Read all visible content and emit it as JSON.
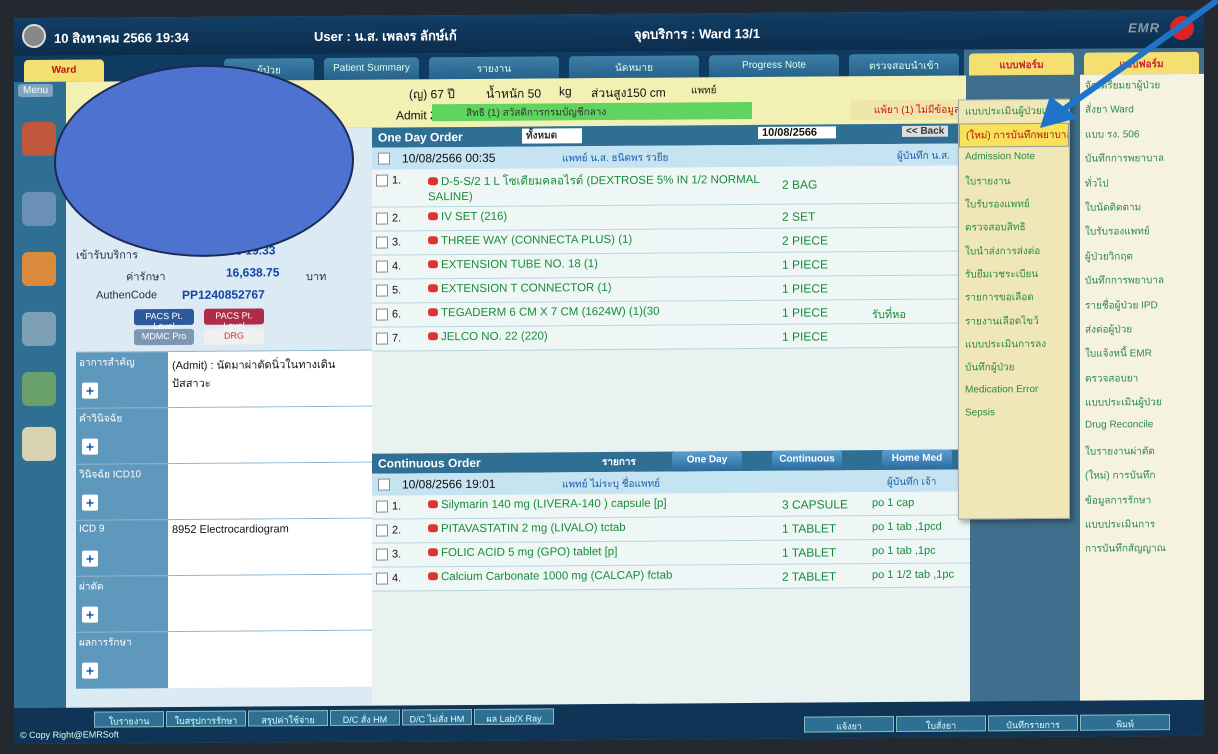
{
  "topbar": {
    "time": "10 สิงหาคม 2566 19:34",
    "user": "User : น.ส. เพลงร ลักษ์เก้",
    "ward": "จุดบริการ : Ward 13/1",
    "brand": "EMR"
  },
  "tabs": [
    "Ward",
    "ผู้ป่วย",
    "Patient Summary",
    "รายงาน",
    "นัดหมาย",
    "Progress Note",
    "ตรวจสอบนำเข้า"
  ],
  "menu": {
    "label": "Menu"
  },
  "header": {
    "age": "(ญ) 67 ปี",
    "weight_label": "น้ำหนัก 50",
    "weight_unit": "kg",
    "height": "ส่วนสูง150 cm",
    "doctor": "แพทย์",
    "admit": "Admit 2 วัน",
    "right": "สิทธิ (1) สวัสดิการกรมบัญชีกลาง",
    "alert": "แพ้ยา (1) ไม่มีข้อมูล"
  },
  "patient": {
    "admit_time_label": "เข้ารับบริการ",
    "admit_time": "10/08/2566 19.33",
    "cost_label": "ค่ารักษา",
    "cost": "16,638.75",
    "cost_unit": "บาท",
    "authen_label": "AuthenCode",
    "authen": "PP1240852767",
    "btn_pacs_pt": "PACS Pt. Level",
    "btn_pacs_pt2": "PACS Pt. Level",
    "btn_mdmc": "MDMC Pro",
    "btn_drg": "DRG",
    "fields": [
      {
        "label": "อาการสำคัญ",
        "value": "(Admit) : นัดมาผ่าตัดนิ่วในทางเดินปัสสาวะ"
      },
      {
        "label": "คำวินิจฉัย",
        "value": ""
      },
      {
        "label": "วินิจฉัย ICD10",
        "value": ""
      },
      {
        "label": "ICD 9",
        "value": "8952 Electrocardiogram"
      },
      {
        "label": "ผ่าตัด",
        "value": ""
      },
      {
        "label": "ผลการรักษา",
        "value": ""
      }
    ]
  },
  "oneday": {
    "title": "One Day Order",
    "filter": "ทั้งหมด",
    "date": "10/08/2566",
    "back": "<< Back",
    "row_date": "10/08/2566 00:35",
    "row_doctor": "แพทย์ น.ส. ธนิดพร รวยีย",
    "row_by": "ผู้บันทึก น.ส.",
    "items": [
      {
        "num": "1.",
        "drug": "D-5-S/2 1 L โซเดียมคลอไรด์ (DEXTROSE 5% IN 1/2 NORMAL SALINE)",
        "qty": "2 BAG"
      },
      {
        "num": "2.",
        "drug": "IV SET (216)",
        "qty": "2 SET"
      },
      {
        "num": "3.",
        "drug": "THREE WAY (CONNECTA PLUS) (1)",
        "qty": "2 PIECE"
      },
      {
        "num": "4.",
        "drug": "EXTENSION TUBE NO. 18 (1)",
        "qty": "1 PIECE"
      },
      {
        "num": "5.",
        "drug": "EXTENSION T CONNECTOR (1)",
        "qty": "1 PIECE"
      },
      {
        "num": "6.",
        "drug": "TEGADERM 6 CM X 7 CM (1624W) (1)(30",
        "qty": "1 PIECE",
        "sig": "รับที่หอ"
      },
      {
        "num": "7.",
        "drug": "JELCO NO. 22 (220)",
        "qty": "1 PIECE"
      }
    ]
  },
  "continuous": {
    "title": "Continuous Order",
    "filter": "รายการ",
    "btn_oneday": "One Day",
    "btn_continuous": "Continuous",
    "btn_homemed": "Home Med",
    "row_date": "10/08/2566 19:01",
    "row_doctor": "แพทย์ ไม่ระบุ ชื่อแพทย์",
    "row_by": "ผู้บันทึก เจ้า",
    "items": [
      {
        "num": "1.",
        "drug": "Silymarin 140 mg (LIVERA-140 ) capsule [p]",
        "qty": "3 CAPSULE",
        "sig": "po 1 cap"
      },
      {
        "num": "2.",
        "drug": "PITAVASTATIN 2 mg (LIVALO) tctab",
        "qty": "1 TABLET",
        "sig": "po 1 tab ,1pcd"
      },
      {
        "num": "3.",
        "drug": "FOLIC ACID 5 mg (GPO) tablet [p]",
        "qty": "1 TABLET",
        "sig": "po 1 tab ,1pc"
      },
      {
        "num": "4.",
        "drug": "Calcium Carbonate 1000 mg (CALCAP) fctab",
        "qty": "2 TABLET",
        "sig": "po 1 1/2 tab ,1pc"
      }
    ]
  },
  "right_tabs": {
    "tab1": "แบบฟอร์ม",
    "tab2": "แบบฟอร์ม"
  },
  "dropdown": [
    "แบบประเมินผู้ป่วยแรก",
    "(ใหม่) การบันทึกพยาบาล",
    "Admission Note",
    "ใบรายงาน",
    "ใบรับรองแพทย์",
    "ตรวจสอบสิทธิ",
    "ใบนำส่งการส่งต่อ",
    "รับยืมเวชระเบียน",
    "รายการขอเลือด",
    "รายงานเลือดไขว้",
    "แบบประเมินการลง",
    "บันทึกผู้ป่วย",
    "Medication Error",
    "Sepsis"
  ],
  "right_menu": [
    "จัดเตรียมยาผู้ป่วย",
    "สั่งยา Ward",
    "แบบ รง. 506",
    "บันทึกการพยาบาล",
    "ทั่วไป",
    "ใบนัดติดตาม",
    "ใบรับรองแพทย์",
    "ผู้ป่วยวิกฤต",
    "บันทึกการพยาบาล",
    "รายชื่อผู้ป่วย IPD",
    "ส่งต่อผู้ป่วย",
    "ใบแจ้งหนี้ EMR",
    "ตรวจสอบยา",
    "แบบประเมินผู้ป่วย",
    "Drug Reconcile",
    "ใบรายงานผ่าตัด",
    "(ใหม่) การบันทึก",
    "ข้อมูลการรักษา",
    "แบบประเมินการ",
    "การบันทึกสัญญาณ"
  ],
  "bottom": {
    "buttons": [
      "ใบรายงาน",
      "ใบสรุปการรักษา",
      "สรุปค่าใช้จ่าย",
      "D/C สั่ง HM",
      "D/C ไม่สั่ง HM",
      "ผล Lab/X Ray"
    ],
    "right_buttons": [
      "แจ้งยา",
      "ใบสั่งยา",
      "บันทึกรายการ",
      "พิมพ์"
    ],
    "copyright": "© Copy Right@EMRSoft"
  },
  "colors": {
    "accent_yellow": "#f3e070",
    "panel_blue": "#2f6f94",
    "drug_green": "#1a8a3a",
    "redaction": "#4d72cf",
    "arrow": "#1f74c9"
  }
}
